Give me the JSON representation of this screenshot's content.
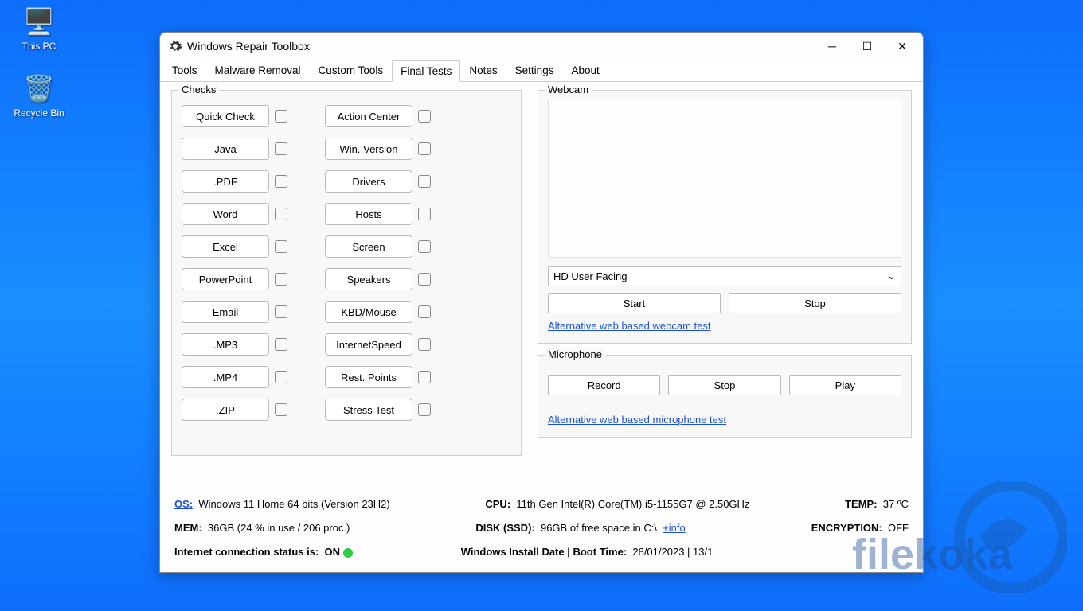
{
  "desktop": {
    "icons": [
      {
        "name": "this-pc",
        "glyph": "🖥️",
        "label": "This PC"
      },
      {
        "name": "recycle-bin",
        "glyph": "🗑️",
        "label": "Recycle Bin"
      }
    ]
  },
  "window": {
    "title": "Windows Repair Toolbox"
  },
  "tabs": [
    "Tools",
    "Malware Removal",
    "Custom Tools",
    "Final Tests",
    "Notes",
    "Settings",
    "About"
  ],
  "active_tab": "Final Tests",
  "checks": {
    "legend": "Checks",
    "left": [
      "Quick Check",
      "Java",
      ".PDF",
      "Word",
      "Excel",
      "PowerPoint",
      "Email",
      ".MP3",
      ".MP4",
      ".ZIP"
    ],
    "right": [
      "Action Center",
      "Win. Version",
      "Drivers",
      "Hosts",
      "Screen",
      "Speakers",
      "KBD/Mouse",
      "InternetSpeed",
      "Rest. Points",
      "Stress Test"
    ]
  },
  "webcam": {
    "legend": "Webcam",
    "device": "HD User Facing",
    "start": "Start",
    "stop": "Stop",
    "alt_link": "Alternative web based webcam test"
  },
  "microphone": {
    "legend": "Microphone",
    "record": "Record",
    "stop": "Stop",
    "play": "Play",
    "alt_link": "Alternative web based microphone test"
  },
  "footer": {
    "os_label": "OS:",
    "os": "Windows 11 Home 64 bits (Version 23H2)",
    "cpu_label": "CPU:",
    "cpu": "11th Gen Intel(R) Core(TM) i5-1155G7 @ 2.50GHz",
    "temp_label": "TEMP:",
    "temp": "37 ºC",
    "mem_label": "MEM:",
    "mem": "36GB  (24 % in use / 206 proc.)",
    "disk_label": "DISK (SSD):",
    "disk": "96GB of free space in C:\\",
    "disk_info": "+info",
    "enc_label": "ENCRYPTION:",
    "enc": "OFF",
    "net_label": "Internet connection status is:",
    "net_status": "ON",
    "install_label": "Windows Install Date | Boot Time:",
    "install": "28/01/2023   |  13/1"
  },
  "watermark_text": "filekoka"
}
